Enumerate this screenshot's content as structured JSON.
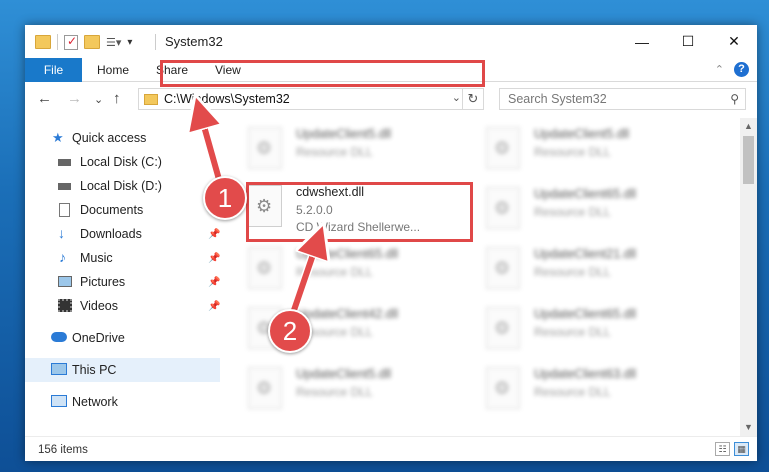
{
  "window": {
    "title": "System32"
  },
  "ribbon": {
    "tabs": [
      "File",
      "Home",
      "Share",
      "View"
    ],
    "help": "?"
  },
  "nav": {
    "back": "←",
    "forward": "→",
    "recent": "⌄",
    "up": "↑",
    "address": "C:\\Windows\\System32",
    "search_placeholder": "Search System32"
  },
  "sidebar": {
    "items": [
      {
        "label": "Quick access",
        "icon": "star-icon"
      },
      {
        "label": "Local Disk (C:)",
        "icon": "drive-icon"
      },
      {
        "label": "Local Disk (D:)",
        "icon": "drive-icon"
      },
      {
        "label": "Documents",
        "icon": "documents-icon"
      },
      {
        "label": "Downloads",
        "icon": "downloads-icon"
      },
      {
        "label": "Music",
        "icon": "music-icon"
      },
      {
        "label": "Pictures",
        "icon": "pictures-icon"
      },
      {
        "label": "Videos",
        "icon": "videos-icon"
      },
      {
        "label": "OneDrive",
        "icon": "cloud-icon"
      },
      {
        "label": "This PC",
        "icon": "computer-icon"
      },
      {
        "label": "Network",
        "icon": "network-icon"
      }
    ]
  },
  "files": {
    "left": [
      {
        "name": "UpdateClient5.dll",
        "desc": "Resource DLL"
      },
      {
        "name": "cdwshext.dll",
        "version": "5.2.0.0",
        "desc": "CD Wizard Shellerwe..."
      },
      {
        "name": "UpdateClient65.dll",
        "desc": "Resource DLL"
      },
      {
        "name": "UpdateClient42.dll",
        "desc": "Resource DLL"
      },
      {
        "name": "UpdateClient5.dll",
        "desc": "Resource DLL"
      }
    ],
    "right": [
      {
        "name": "UpdateClient5.dll",
        "desc": "Resource DLL"
      },
      {
        "name": "UpdateClient65.dll",
        "desc": "Resource DLL"
      },
      {
        "name": "UpdateClient21.dll",
        "desc": "Resource DLL"
      },
      {
        "name": "UpdateClient65.dll",
        "desc": "Resource DLL"
      },
      {
        "name": "UpdateClient63.dll",
        "desc": "Resource DLL"
      }
    ]
  },
  "status": {
    "count": "156 items"
  },
  "callouts": [
    "1",
    "2"
  ],
  "colors": {
    "accent": "#1979ca",
    "highlight": "#e04848"
  }
}
